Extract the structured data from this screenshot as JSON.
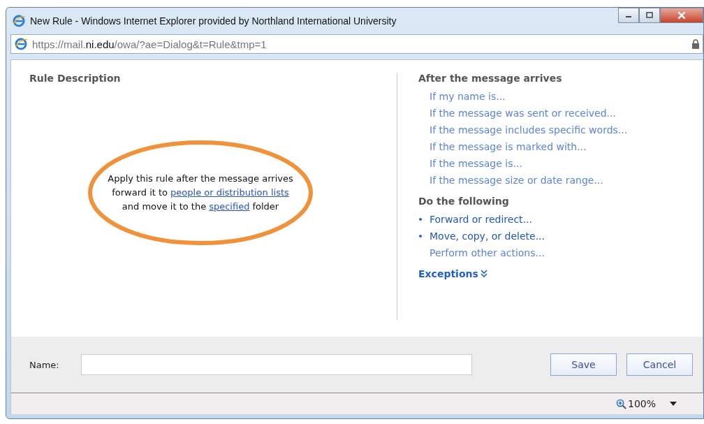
{
  "window": {
    "title": "New Rule - Windows Internet Explorer provided by Northland International University"
  },
  "address_bar": {
    "url": "https://mail.**ni.edu**/owa/?ae=Dialog&t=Rule&tmp=1"
  },
  "rule_description": {
    "heading": "Rule Description",
    "lines": [
      {
        "parts": [
          {
            "kind": "text",
            "text": "Apply this rule after the message arrives"
          }
        ]
      },
      {
        "parts": [
          {
            "kind": "text",
            "text": "forward it to"
          },
          {
            "kind": "link",
            "text": "people or distribution lists"
          }
        ]
      },
      {
        "parts": [
          {
            "kind": "text",
            "text": "and move it to the"
          },
          {
            "kind": "link",
            "text": "specified"
          },
          {
            "kind": "text",
            "text": "folder"
          }
        ]
      }
    ]
  },
  "conditions": {
    "heading": "After the message arrives",
    "items": [
      {
        "label": "If my name is...",
        "bulleted": false
      },
      {
        "label": "If the message was sent or received...",
        "bulleted": false
      },
      {
        "label": "If the message includes specific words...",
        "bulleted": false
      },
      {
        "label": "If the message is marked with...",
        "bulleted": false
      },
      {
        "label": "If the message is...",
        "bulleted": false
      },
      {
        "label": "If the message size or date range...",
        "bulleted": false
      }
    ]
  },
  "actions": {
    "heading": "Do the following",
    "items": [
      {
        "label": "Forward or redirect...",
        "bulleted": true
      },
      {
        "label": "Move, copy, or delete...",
        "bulleted": true
      },
      {
        "label": "Perform other actions...",
        "bulleted": false
      }
    ]
  },
  "exceptions": {
    "label": "Exceptions",
    "expanded": false
  },
  "name_field": {
    "label": "Name:"
  },
  "buttons": [
    "Save",
    "Cancel"
  ],
  "status_bar": {
    "zoom": "100%"
  }
}
